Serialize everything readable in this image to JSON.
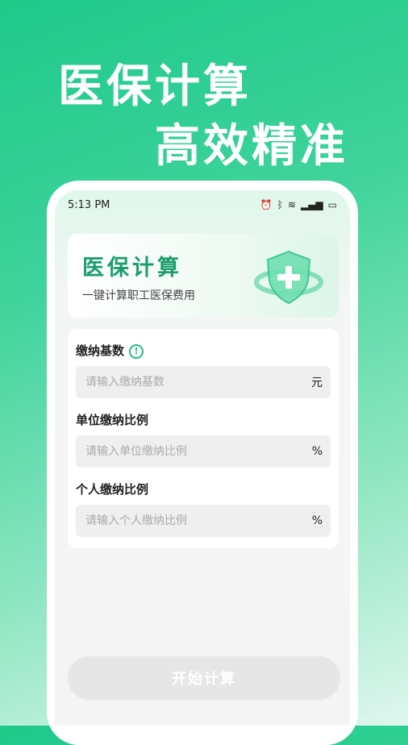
{
  "headline": {
    "line1": "医保计算",
    "line2": "高效精准"
  },
  "status_bar": {
    "time": "5:13 PM",
    "icons": [
      "alarm-icon",
      "bluetooth-icon",
      "wifi-icon",
      "signal-icon",
      "battery-icon"
    ]
  },
  "banner": {
    "title": "医保计算",
    "subtitle": "一键计算职工医保费用"
  },
  "form": {
    "fields": [
      {
        "label": "缴纳基数",
        "placeholder": "请输入缴纳基数",
        "unit": "元",
        "value": ""
      },
      {
        "label": "单位缴纳比例",
        "placeholder": "请输入单位缴纳比例",
        "unit": "%",
        "value": ""
      },
      {
        "label": "个人缴纳比例",
        "placeholder": "请输入个人缴纳比例",
        "unit": "%",
        "value": ""
      }
    ]
  },
  "button": {
    "start_label": "开始计算"
  },
  "colors": {
    "accent": "#1a9e6b",
    "bg_green": "#1ec98a",
    "button_disabled": "#e6e6e6"
  }
}
